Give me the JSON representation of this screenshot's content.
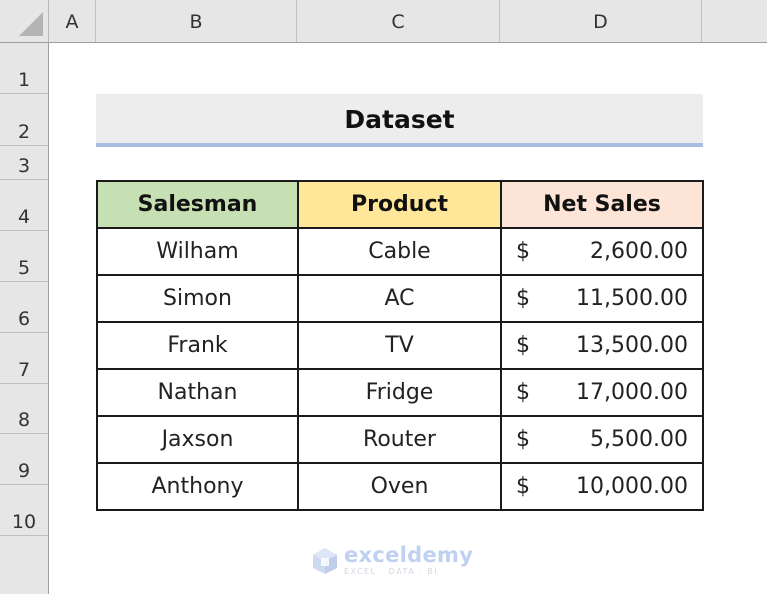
{
  "sheet": {
    "columns": [
      "A",
      "B",
      "C",
      "D"
    ],
    "rows": [
      "1",
      "2",
      "3",
      "4",
      "5",
      "6",
      "7",
      "8",
      "9",
      "10"
    ]
  },
  "title": "Dataset",
  "table": {
    "headers": [
      "Salesman",
      "Product",
      "Net Sales"
    ],
    "header_colors": [
      "#c6e0b4",
      "#ffe699",
      "#fce4d6"
    ],
    "currency_symbol": "$",
    "rows": [
      {
        "salesman": "Wilham",
        "product": "Cable",
        "net_sales": "2,600.00"
      },
      {
        "salesman": "Simon",
        "product": "AC",
        "net_sales": "11,500.00"
      },
      {
        "salesman": "Frank",
        "product": "TV",
        "net_sales": "13,500.00"
      },
      {
        "salesman": "Nathan",
        "product": "Fridge",
        "net_sales": "17,000.00"
      },
      {
        "salesman": "Jaxson",
        "product": "Router",
        "net_sales": "5,500.00"
      },
      {
        "salesman": "Anthony",
        "product": "Oven",
        "net_sales": "10,000.00"
      }
    ]
  },
  "watermark": {
    "name": "exceldemy",
    "tagline": "EXCEL · DATA · BI",
    "icon": "exceldemy-logo-icon"
  }
}
